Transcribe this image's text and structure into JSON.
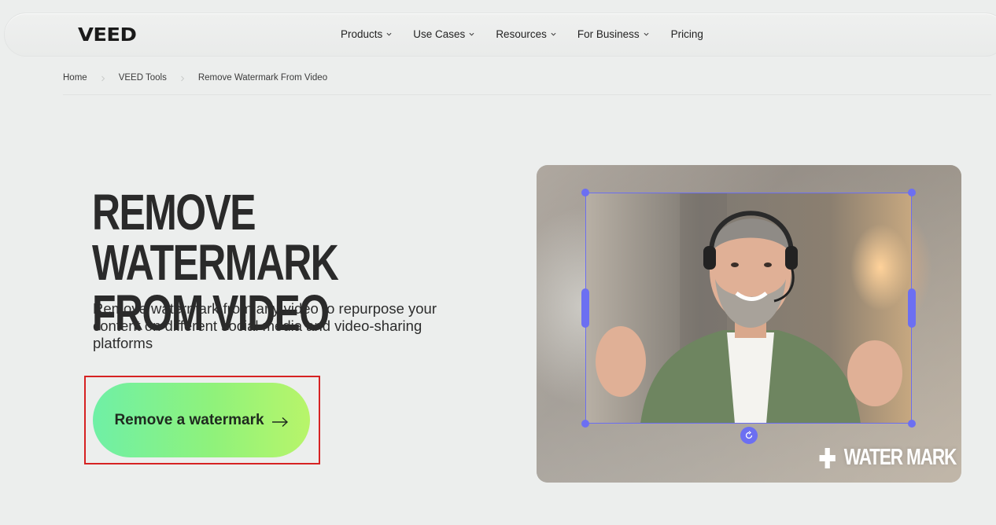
{
  "brand": {
    "logo_text": "VEED"
  },
  "nav": {
    "items": [
      {
        "label": "Products",
        "has_dropdown": true
      },
      {
        "label": "Use Cases",
        "has_dropdown": true
      },
      {
        "label": "Resources",
        "has_dropdown": true
      },
      {
        "label": "For Business",
        "has_dropdown": true
      },
      {
        "label": "Pricing",
        "has_dropdown": false
      }
    ]
  },
  "breadcrumb": {
    "items": [
      "Home",
      "VEED Tools",
      "Remove Watermark From Video"
    ]
  },
  "hero": {
    "title_line1": "REMOVE WATERMARK",
    "title_line2": "FROM VIDEO",
    "subtitle": "Remove watermark from any video to repurpose your content on different social media and video-sharing platforms",
    "cta_label": "Remove a watermark"
  },
  "media": {
    "watermark_text": "WATER MARK"
  },
  "colors": {
    "accent_selection": "#6c6ff2",
    "cta_gradient_start": "#6ff0a6",
    "cta_gradient_end": "#b8f56a",
    "highlight_frame": "#d62222"
  }
}
